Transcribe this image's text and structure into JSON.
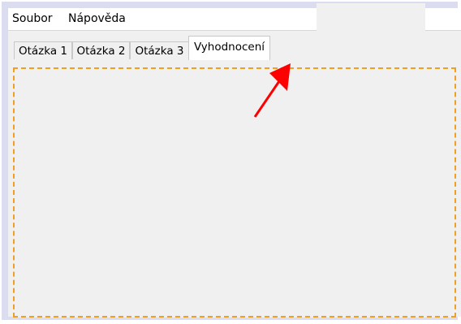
{
  "menubar": {
    "items": [
      "Soubor",
      "Nápověda"
    ]
  },
  "tabs": [
    {
      "label": "Otázka 1"
    },
    {
      "label": "Otázka 2"
    },
    {
      "label": "Otázka 3"
    },
    {
      "label": "Vyhodnocení",
      "selected": true
    }
  ],
  "colors": {
    "panel_border": "#f0a020",
    "arrow": "#ff0000",
    "window_frame": "#dcdcf0"
  }
}
